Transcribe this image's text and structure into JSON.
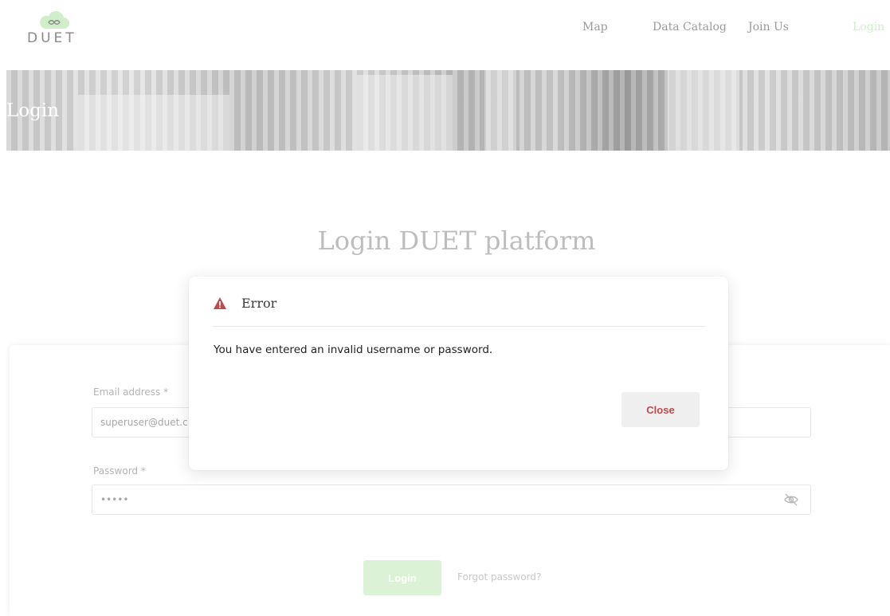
{
  "header": {
    "logo_text": "DUET",
    "nav": [
      {
        "label": "Map",
        "active": false
      },
      {
        "label": "Data Catalog",
        "active": false
      },
      {
        "label": "Join Us",
        "active": false
      },
      {
        "label": "Login",
        "active": true
      }
    ]
  },
  "hero": {
    "title": "Login"
  },
  "main": {
    "heading": "Login DUET platform",
    "email": {
      "label": "Email address *",
      "value": "superuser@duet.c"
    },
    "password": {
      "label": "Password *",
      "value": "•••••"
    },
    "login_button": "Login",
    "forgot_link": "Forgot password?"
  },
  "modal": {
    "title": "Error",
    "message": "You have entered an invalid username or password.",
    "close_button": "Close"
  },
  "colors": {
    "accent_green": "#cfeec9",
    "error_red": "#c04a4a"
  }
}
